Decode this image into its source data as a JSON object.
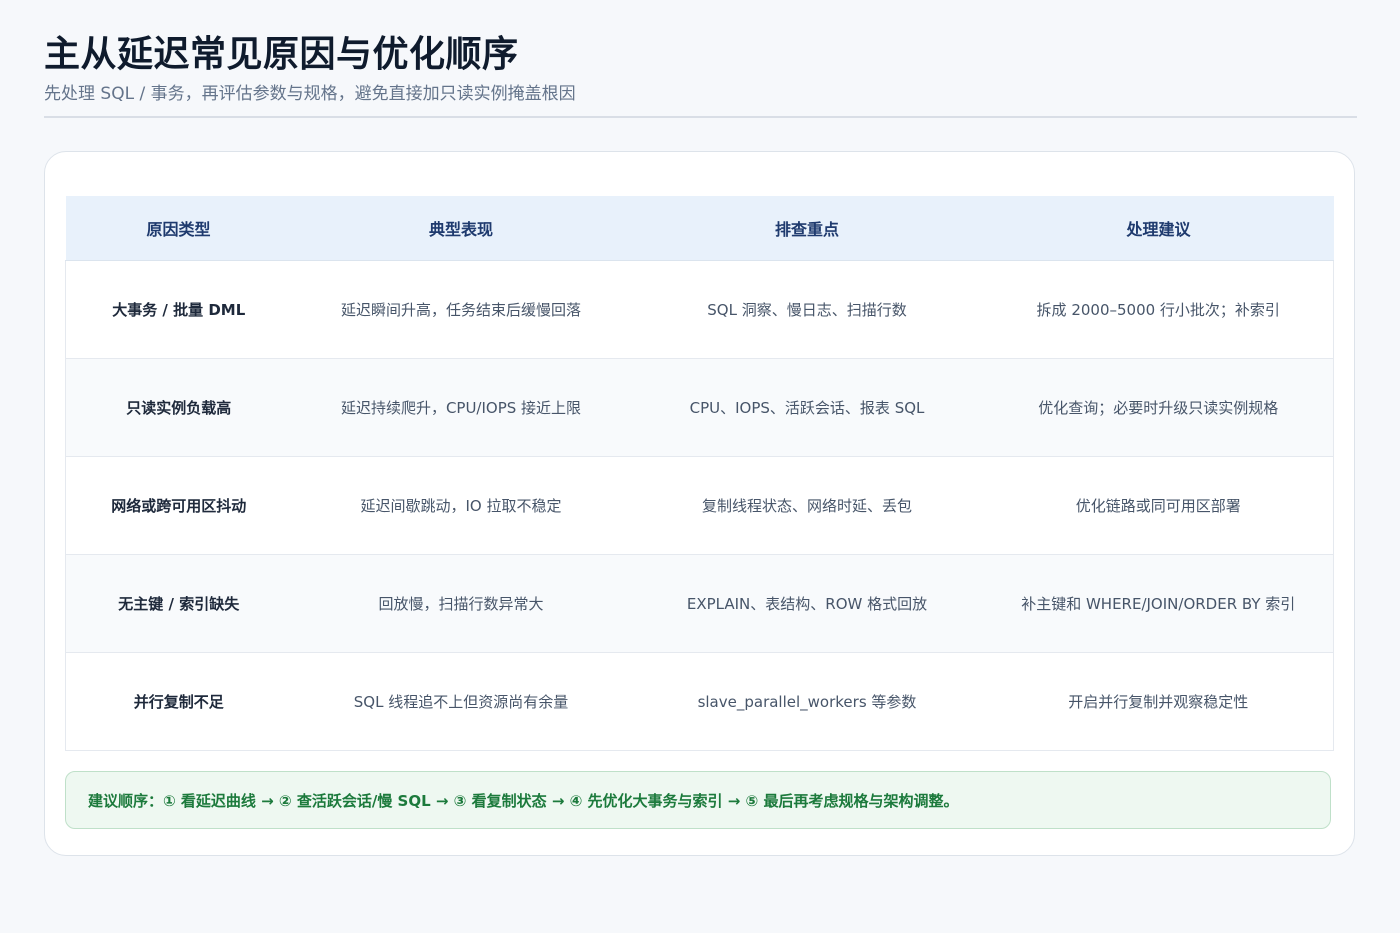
{
  "header": {
    "title": "主从延迟常见原因与优化顺序",
    "subtitle": "先处理 SQL / 事务，再评估参数与规格，避免直接加只读实例掩盖根因"
  },
  "table": {
    "columns": [
      "原因类型",
      "典型表现",
      "排查重点",
      "处理建议"
    ],
    "rows": [
      [
        "大事务 / 批量 DML",
        "延迟瞬间升高，任务结束后缓慢回落",
        "SQL 洞察、慢日志、扫描行数",
        "拆成 2000–5000 行小批次；补索引"
      ],
      [
        "只读实例负载高",
        "延迟持续爬升，CPU/IOPS 接近上限",
        "CPU、IOPS、活跃会话、报表 SQL",
        "优化查询；必要时升级只读实例规格"
      ],
      [
        "网络或跨可用区抖动",
        "延迟间歇跳动，IO 拉取不稳定",
        "复制线程状态、网络时延、丢包",
        "优化链路或同可用区部署"
      ],
      [
        "无主键 / 索引缺失",
        "回放慢，扫描行数异常大",
        "EXPLAIN、表结构、ROW 格式回放",
        "补主键和 WHERE/JOIN/ORDER BY 索引"
      ],
      [
        "并行复制不足",
        "SQL 线程追不上但资源尚有余量",
        "slave_parallel_workers 等参数",
        "开启并行复制并观察稳定性"
      ]
    ]
  },
  "recommendation": "建议顺序：① 看延迟曲线 → ② 查活跃会话/慢 SQL → ③ 看复制状态 → ④ 先优化大事务与索引 → ⑤ 最后再考虑规格与架构调整。"
}
